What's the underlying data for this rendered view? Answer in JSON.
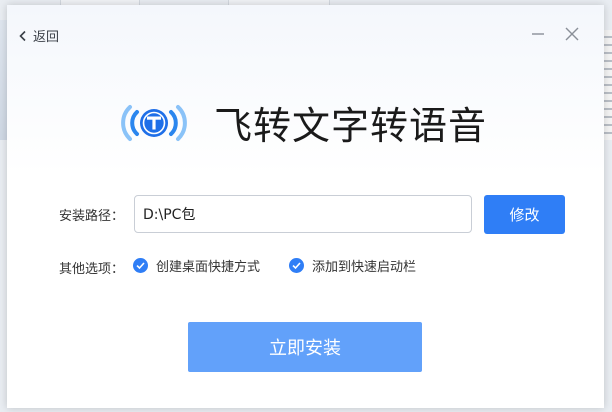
{
  "header": {
    "back_label": "返回"
  },
  "brand": {
    "icon": "broadcast-t-logo",
    "title": "飞转文字转语音"
  },
  "install_path": {
    "label": "安装路径：",
    "value": "D:\\PC包",
    "modify_label": "修改"
  },
  "options": {
    "label": "其他选项：",
    "items": [
      {
        "label": "创建桌面快捷方式",
        "checked": true
      },
      {
        "label": "添加到快速启动栏",
        "checked": true
      }
    ]
  },
  "install_button_label": "立即安装",
  "colors": {
    "accent": "#2f7ef6",
    "install_button": "#62a1fa"
  }
}
